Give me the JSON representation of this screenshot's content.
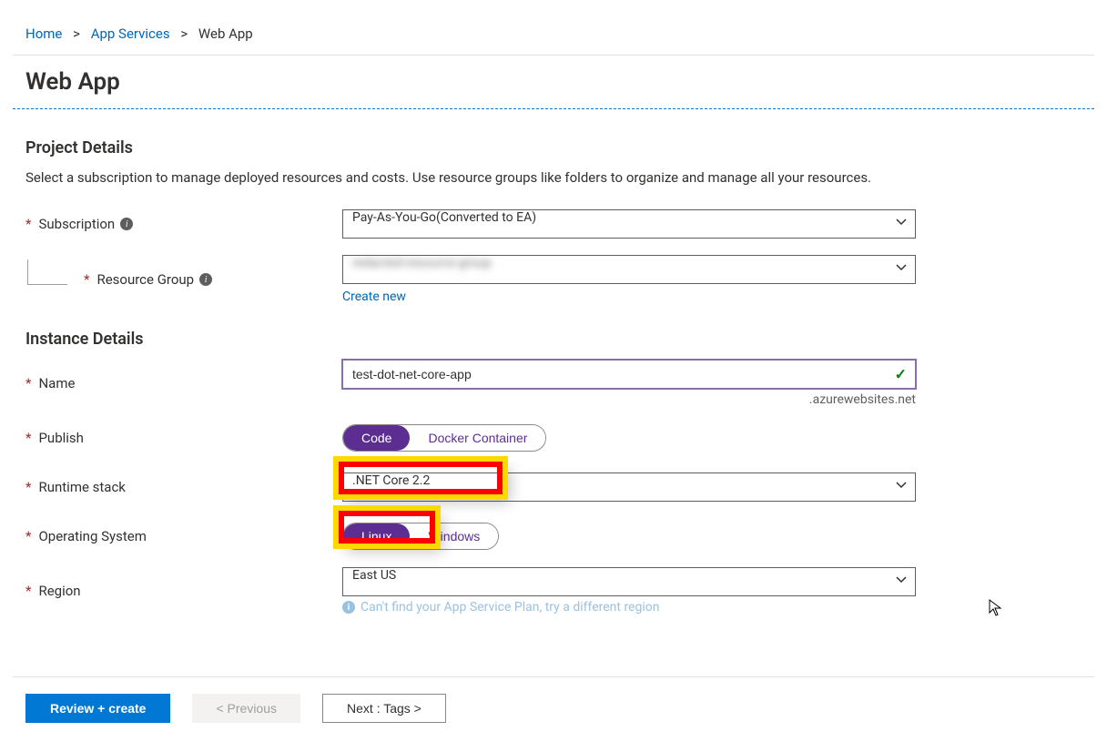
{
  "breadcrumb": {
    "home": "Home",
    "level1": "App Services",
    "current": "Web App"
  },
  "page_title": "Web App",
  "project_details": {
    "heading": "Project Details",
    "description": "Select a subscription to manage deployed resources and costs. Use resource groups like folders to organize and manage all your resources.",
    "subscription_label": "Subscription",
    "subscription_value": "Pay-As-You-Go(Converted to EA)",
    "resource_group_label": "Resource Group",
    "resource_group_value": "redacted-resource-group",
    "create_new": "Create new"
  },
  "instance_details": {
    "heading": "Instance Details",
    "name_label": "Name",
    "name_value": "test-dot-net-core-app",
    "domain_suffix": ".azurewebsites.net",
    "publish_label": "Publish",
    "publish_options": {
      "code": "Code",
      "docker": "Docker Container"
    },
    "runtime_label": "Runtime stack",
    "runtime_value": ".NET Core 2.2",
    "os_label": "Operating System",
    "os_options": {
      "linux": "Linux",
      "windows": "Windows"
    },
    "region_label": "Region",
    "region_value": "East US",
    "region_hint": "Can't find your App Service Plan, try a different region"
  },
  "footer": {
    "review": "Review + create",
    "previous": "< Previous",
    "next": "Next : Tags >"
  }
}
